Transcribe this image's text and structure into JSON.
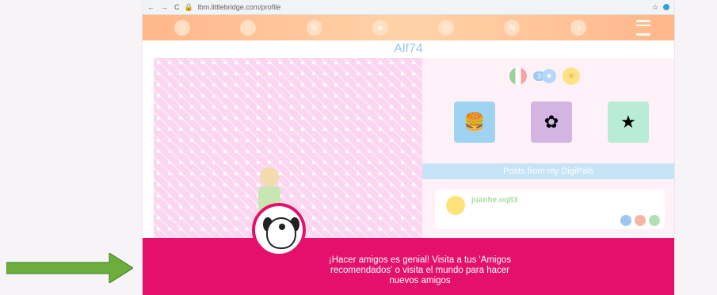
{
  "browser": {
    "url": "lbm.littlebridge.com/profile"
  },
  "profile": {
    "username": "Alf74"
  },
  "nav": {
    "icons": [
      "home-icon",
      "globe-icon",
      "pencil-icon",
      "world-icon",
      "clock-icon",
      "pencil-icon",
      "bell-icon",
      "menu-icon"
    ]
  },
  "stats": {
    "friends_count": "3"
  },
  "posts": {
    "header": "Posts from my DigiPals",
    "items": [
      {
        "user": "juanhe.oq83"
      }
    ]
  },
  "banner": {
    "message": "¡Hacer amigos es genial! Visita a tus 'Amigos recomendados' o visita el mundo para hacer nuevos amigos"
  },
  "colors": {
    "banner": "#e4106b",
    "arrow": "#6cad3c",
    "username": "#9ec8ea"
  }
}
